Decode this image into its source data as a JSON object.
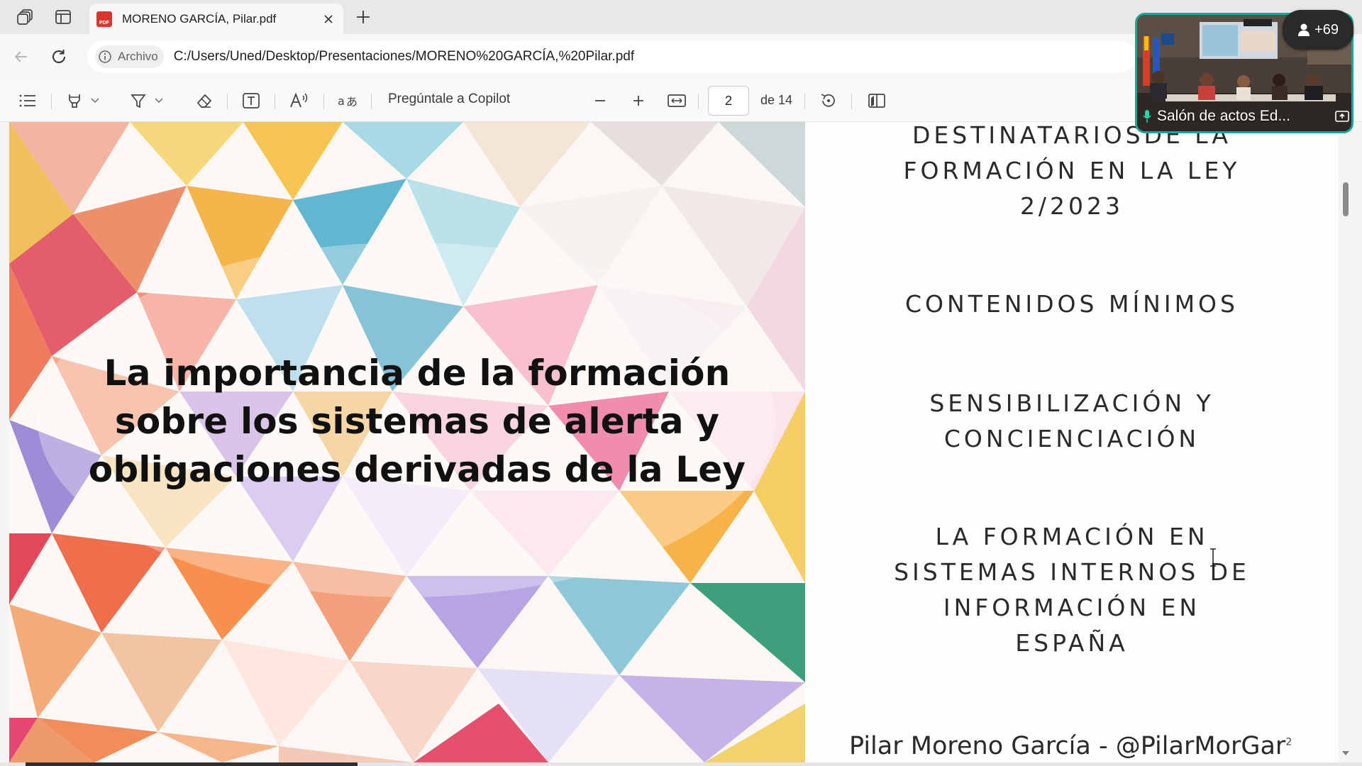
{
  "browser": {
    "tab": {
      "title": "MORENO GARCÍA, Pilar.pdf",
      "badge": "PDF"
    },
    "address": {
      "site_info_label": "Archivo",
      "url": "C:/Users/Uned/Desktop/Presentaciones/MORENO%20GARCÍA,%20Pilar.pdf"
    }
  },
  "pdf_toolbar": {
    "copilot_label": "Pregúntale a Copilot",
    "current_page": "2",
    "page_total_label": "de 14",
    "scroll_position_fraction": 0.08
  },
  "document": {
    "left_slide": {
      "title_lines": [
        "La importancia de la formación",
        "sobre los sistemas de alerta y",
        "obligaciones derivadas de la Ley"
      ]
    },
    "right_slide": {
      "items": [
        {
          "lines": [
            "DESTINATARIOSDE LA",
            "FORMACIÓN EN LA LEY",
            "2/2023"
          ]
        },
        {
          "lines": [
            "CONTENIDOS MÍNIMOS"
          ]
        },
        {
          "lines": [
            "SENSIBILIZACIÓN Y",
            "CONCIENCIACIÓN"
          ]
        },
        {
          "lines": [
            "LA FORMACIÓN EN",
            "SISTEMAS INTERNOS DE",
            "INFORMACIÓN EN",
            "ESPAÑA"
          ]
        }
      ],
      "footer": "Pilar Moreno García - @PilarMorGar",
      "page_number": "2"
    }
  },
  "video_call": {
    "participants_label": "+69",
    "room_label": "Salón de actos Ed...",
    "accent_color": "#1aa79a"
  },
  "icons": [
    "workspaces-icon",
    "tab-actions-icon",
    "pdf-icon",
    "close-icon",
    "new-tab-icon",
    "back-icon",
    "refresh-icon",
    "info-icon",
    "contents-icon",
    "highlight-icon",
    "draw-icon",
    "eraser-icon",
    "text-box-icon",
    "read-aloud-icon",
    "translate-icon",
    "zoom-out-icon",
    "zoom-in-icon",
    "fit-width-icon",
    "rotate-icon",
    "page-view-icon",
    "person-icon",
    "microphone-icon",
    "popout-icon",
    "text-cursor-icon"
  ]
}
